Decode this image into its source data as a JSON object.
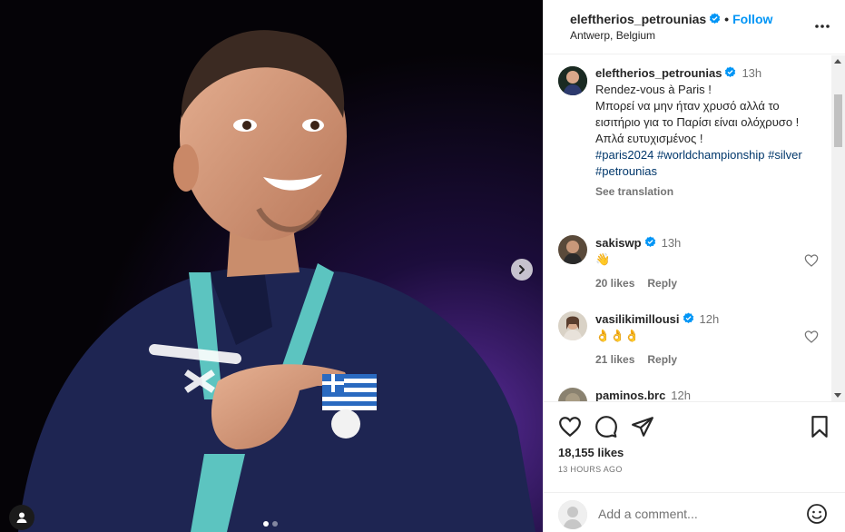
{
  "media": {
    "next_icon": "chevron-right-icon",
    "tag_icon": "user-tag-icon",
    "carousel": {
      "count": 2,
      "active_index": 0
    }
  },
  "header": {
    "username": "eleftherios_petrounias",
    "separator": "•",
    "follow_label": "Follow",
    "location": "Antwerp, Belgium",
    "more_icon": "more-horizontal-icon"
  },
  "caption": {
    "username": "eleftherios_petrounias",
    "time": "13h",
    "lines": [
      "Rendez-vous à Paris !",
      "Μπορεί να μην ήταν χρυσό αλλά το εισιτήριο για το Παρίσι είναι ολόχρυσο !",
      "Απλά ευτυχισμένος !"
    ],
    "hashtags": [
      "#paris2024",
      "#worldchampionship",
      "#silver",
      "#petrounias"
    ],
    "see_translation": "See translation"
  },
  "comments": [
    {
      "username": "sakiswp",
      "time": "13h",
      "text": "👋",
      "likes": "20 likes",
      "reply": "Reply"
    },
    {
      "username": "vasilikimillousi",
      "time": "12h",
      "text": "👌👌👌",
      "likes": "21 likes",
      "reply": "Reply"
    },
    {
      "username": "paminos.brc",
      "time": "12h",
      "text": "",
      "likes": "",
      "reply": ""
    }
  ],
  "actions": {
    "like_icon": "heart-icon",
    "comment_icon": "comment-icon",
    "share_icon": "share-icon",
    "save_icon": "bookmark-icon",
    "likes": "18,155 likes",
    "posted": "13 HOURS AGO"
  },
  "add_comment": {
    "placeholder": "Add a comment...",
    "emoji_icon": "emoji-icon"
  },
  "colors": {
    "accent": "#0095f6",
    "hashtag": "#00376b",
    "muted": "#737373",
    "text": "#262626"
  }
}
